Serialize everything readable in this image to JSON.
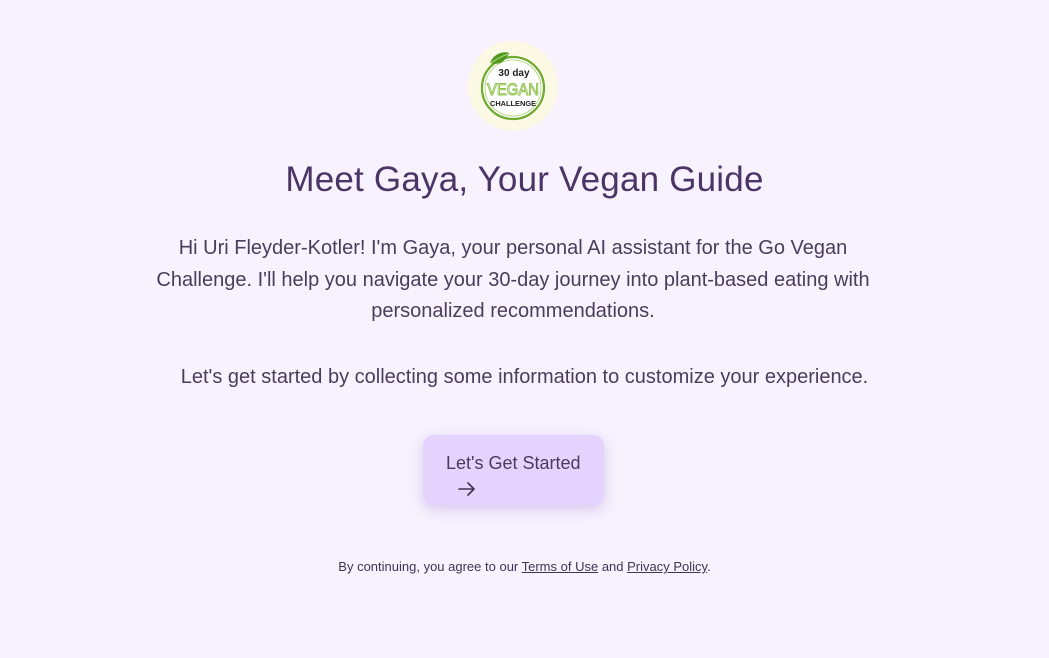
{
  "logo": {
    "line1": "30 day",
    "line2": "VEGAN",
    "line3": "CHALLENGE",
    "icon": "leaf-icon",
    "colors": {
      "ring": "#6cab2e",
      "leaf": "#4f9a1f",
      "vegan_text": "#8fc24a",
      "dark_text": "#222222",
      "badge_bg": "#fbf8e4"
    }
  },
  "heading": {
    "title": "Meet Gaya, Your Vegan Guide"
  },
  "intro": {
    "text": "Hi Uri Fleyder-Kotler! I'm Gaya, your personal AI assistant for the Go Vegan Challenge. I'll help you navigate your 30-day journey into plant-based eating with personalized recommendations.",
    "subtext": "Let's get started by collecting some information to customize your experience."
  },
  "cta": {
    "label": "Let's Get Started",
    "icon": "arrow-right-icon"
  },
  "footer": {
    "prefix": "By continuing, you agree to our ",
    "terms": "Terms of Use",
    "and": " and ",
    "privacy": "Privacy Policy",
    "suffix": "."
  },
  "colors": {
    "background": "#f7f2fd",
    "heading": "#4a3566",
    "body_text": "#4a3d5c",
    "button_bg": "#e3d3fd"
  }
}
